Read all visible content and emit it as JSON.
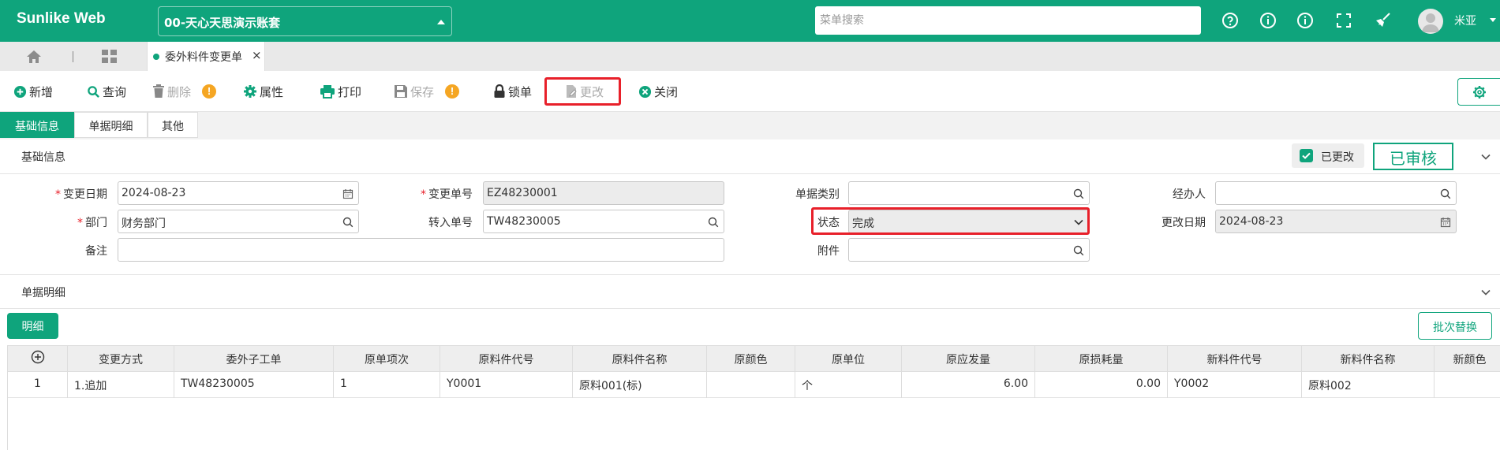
{
  "header": {
    "brand": "Sunlike Web",
    "account": "00-天心天思演示账套",
    "search_placeholder": "菜单搜索",
    "user_name": "米亚"
  },
  "tabs": {
    "active_tab": "委外料件变更单"
  },
  "toolbar": {
    "add": "新增",
    "query": "查询",
    "delete": "删除",
    "delete_warn": "!",
    "properties": "属性",
    "print": "打印",
    "save": "保存",
    "save_warn": "!",
    "lock": "锁单",
    "modify": "更改",
    "close": "关闭"
  },
  "subtabs": [
    "基础信息",
    "单据明细",
    "其他"
  ],
  "base_info": {
    "title": "基础信息",
    "changed_label": "已更改",
    "audit_stamp": "已审核",
    "fields": {
      "change_date_label": "变更日期",
      "change_date": "2024-08-23",
      "change_no_label": "变更单号",
      "change_no": "EZ48230001",
      "doc_type_label": "单据类别",
      "doc_type": "",
      "handler_label": "经办人",
      "handler": "",
      "dept_label": "部门",
      "dept": "财务部门",
      "transfer_no_label": "转入单号",
      "transfer_no": "TW48230005",
      "status_label": "状态",
      "status": "完成",
      "modify_date_label": "更改日期",
      "modify_date": "2024-08-23",
      "remark_label": "备注",
      "remark": "",
      "attachment_label": "附件",
      "attachment": ""
    }
  },
  "detail": {
    "title": "单据明细",
    "detail_button": "明细",
    "batch_replace_button": "批次替换",
    "columns": [
      "变更方式",
      "委外子工单",
      "原单项次",
      "原料件代号",
      "原料件名称",
      "原颜色",
      "原单位",
      "原应发量",
      "原损耗量",
      "新料件代号",
      "新料件名称",
      "新颜色"
    ],
    "rows": [
      [
        "1",
        "1.追加",
        "TW48230005",
        "1",
        "Y0001",
        "原料001(标)",
        "",
        "个",
        "6.00",
        "0.00",
        "Y0002",
        "原料002",
        ""
      ]
    ]
  },
  "colors": {
    "primary": "#0fa47c",
    "highlight": "#e8202a",
    "warning": "#f5a623"
  }
}
